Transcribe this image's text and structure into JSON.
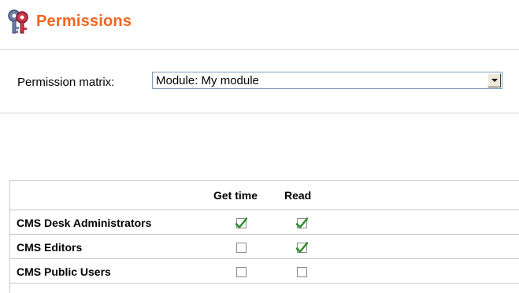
{
  "header": {
    "title": "Permissions",
    "icon": "keys-icon"
  },
  "matrix": {
    "label": "Permission matrix:",
    "selected": "Module: My module"
  },
  "table": {
    "columns": [
      "Get time",
      "Read"
    ],
    "rows": [
      {
        "name": "CMS Desk Administrators",
        "permissions": [
          true,
          true
        ]
      },
      {
        "name": "CMS Editors",
        "permissions": [
          false,
          true
        ]
      },
      {
        "name": "CMS Public Users",
        "permissions": [
          false,
          false
        ]
      }
    ]
  },
  "colors": {
    "title": "#f26522",
    "check": "#2a9a2a",
    "divider": "#d6d6d6"
  }
}
